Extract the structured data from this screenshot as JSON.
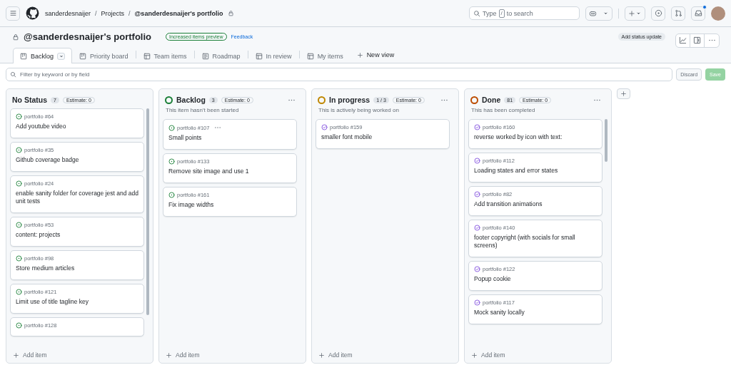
{
  "topbar": {
    "breadcrumbs": [
      {
        "label": "sanderdesnaijer",
        "current": false
      },
      {
        "separator": "/",
        "label": "Projects",
        "current": false
      },
      {
        "separator": "/",
        "label": "@sanderdesnaijer's portfolio",
        "current": true
      }
    ],
    "search": {
      "prefix": "Type",
      "key": "/",
      "suffix": "to search"
    },
    "unread": true
  },
  "project": {
    "title": "@sanderdesnaijer's portfolio",
    "badge": "Increased items preview",
    "feedback": "Feedback",
    "status_button": "Add status update"
  },
  "tabs": [
    {
      "label": "Backlog",
      "kind": "board",
      "selected": true
    },
    {
      "label": "Priority board",
      "kind": "board",
      "selected": false
    },
    {
      "label": "Team items",
      "kind": "table",
      "selected": false
    },
    {
      "label": "Roadmap",
      "kind": "roadmap",
      "selected": false
    },
    {
      "label": "In review",
      "kind": "table",
      "selected": false
    },
    {
      "label": "My items",
      "kind": "table",
      "selected": false
    }
  ],
  "new_view": "New view",
  "filter": {
    "placeholder": "Filter by keyword or by field",
    "discard": "Discard",
    "save": "Save",
    "save_disabled": true
  },
  "columns": [
    {
      "name": "No Status",
      "count": "7",
      "estimate": "Estimate: 0",
      "scrollable": true,
      "add": "Add item",
      "items": [
        {
          "ref": "portfolio #64",
          "title": "Add youtube video",
          "kind": "open"
        },
        {
          "ref": "portfolio #35",
          "title": "Github coverage badge",
          "kind": "open"
        },
        {
          "ref": "portfolio #24",
          "title": "enable sanity folder for coverage jest and add unit tests",
          "kind": "open"
        },
        {
          "ref": "portfolio #53",
          "title": "content: projects",
          "kind": "open"
        },
        {
          "ref": "portfolio #98",
          "title": "Store medium articles",
          "kind": "open"
        },
        {
          "ref": "portfolio #121",
          "title": "Limit use of title tagline key",
          "kind": "open"
        },
        {
          "ref": "portfolio #128",
          "kind": "open"
        }
      ]
    },
    {
      "name": "Backlog",
      "count": "3",
      "estimate": "Estimate: 0",
      "color": "#1a7f37",
      "description": "This item hasn't been started",
      "scrollable": false,
      "add": "Add item",
      "items": [
        {
          "ref": "portfolio #107",
          "title": "Small points",
          "kind": "open",
          "menu_visible": true
        },
        {
          "ref": "portfolio #133",
          "title": "Remove site image and use 1",
          "kind": "open"
        },
        {
          "ref": "portfolio #161",
          "title": "Fix image widths",
          "kind": "open"
        }
      ]
    },
    {
      "name": "In progress",
      "count": "1 / 3",
      "estimate": "Estimate: 0",
      "color": "#bf8700",
      "description": "This is actively being worked on",
      "scrollable": false,
      "add": "Add item",
      "items": [
        {
          "ref": "portfolio #159",
          "title": "smaller font mobile",
          "kind": "done"
        }
      ]
    },
    {
      "name": "Done",
      "count": "81",
      "estimate": "Estimate: 0",
      "color": "#bc4c00",
      "description": "This has been completed",
      "scrollable": true,
      "add": "Add item",
      "items": [
        {
          "ref": "portfolio #160",
          "title": "reverse worked by icon with text:",
          "kind": "done"
        },
        {
          "ref": "portfolio #112",
          "title": "Loading states and error states",
          "kind": "done"
        },
        {
          "ref": "portfolio #82",
          "title": "Add transition animations",
          "kind": "done"
        },
        {
          "ref": "portfolio #140",
          "title": "footer copyright (with socials for small screens)",
          "kind": "done"
        },
        {
          "ref": "portfolio #122",
          "title": "Popup cookie",
          "kind": "done"
        },
        {
          "ref": "portfolio #117",
          "title": "Mock sanity locally",
          "kind": "done"
        }
      ]
    }
  ]
}
